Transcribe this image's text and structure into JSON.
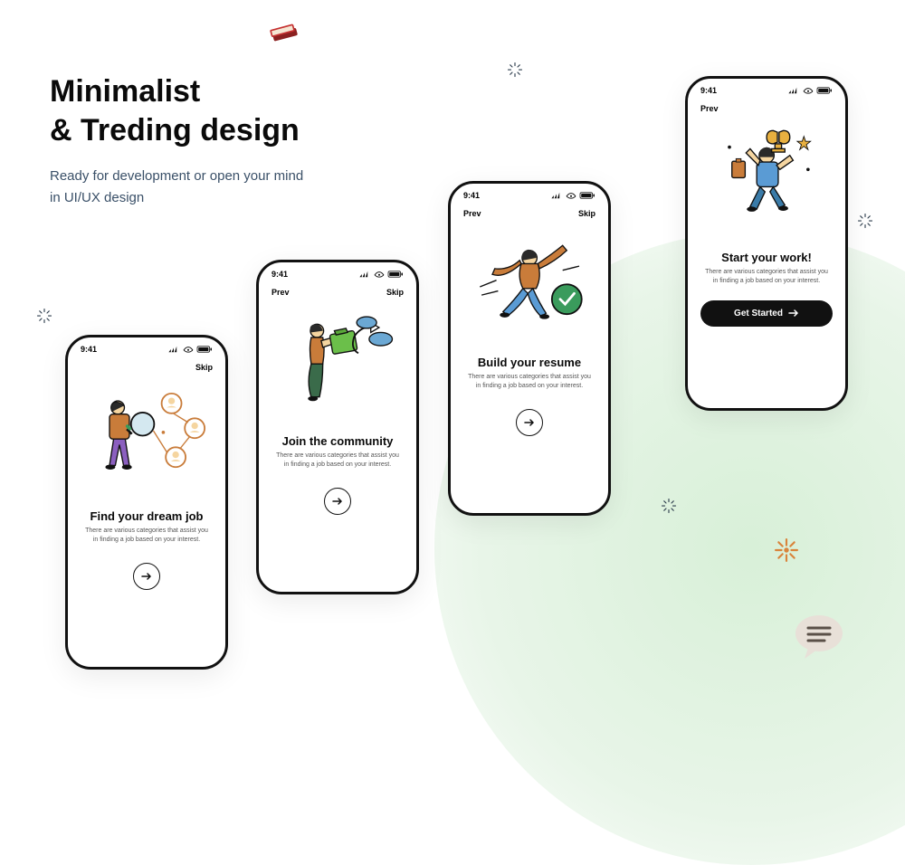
{
  "heading": {
    "line1": "Minimalist",
    "line2": "& Treding design",
    "sub1": "Ready for development or open your mind",
    "sub2": "in UI/UX design"
  },
  "status_time": "9:41",
  "screens": [
    {
      "prev": "",
      "skip": "Skip",
      "title": "Find your dream job",
      "desc": "There are various categories that assist you in finding a job based on your interest.",
      "action": "next"
    },
    {
      "prev": "Prev",
      "skip": "Skip",
      "title": "Join the community",
      "desc": "There are various categories that assist you in finding a job based on your interest.",
      "action": "next"
    },
    {
      "prev": "Prev",
      "skip": "Skip",
      "title": "Build your resume",
      "desc": "There are various categories that assist you in finding a job based on your interest.",
      "action": "next"
    },
    {
      "prev": "Prev",
      "skip": "",
      "title": "Start your work!",
      "desc": "There are various categories that assist you in finding a job based on your interest.",
      "action": "cta",
      "cta_label": "Get Started"
    }
  ]
}
